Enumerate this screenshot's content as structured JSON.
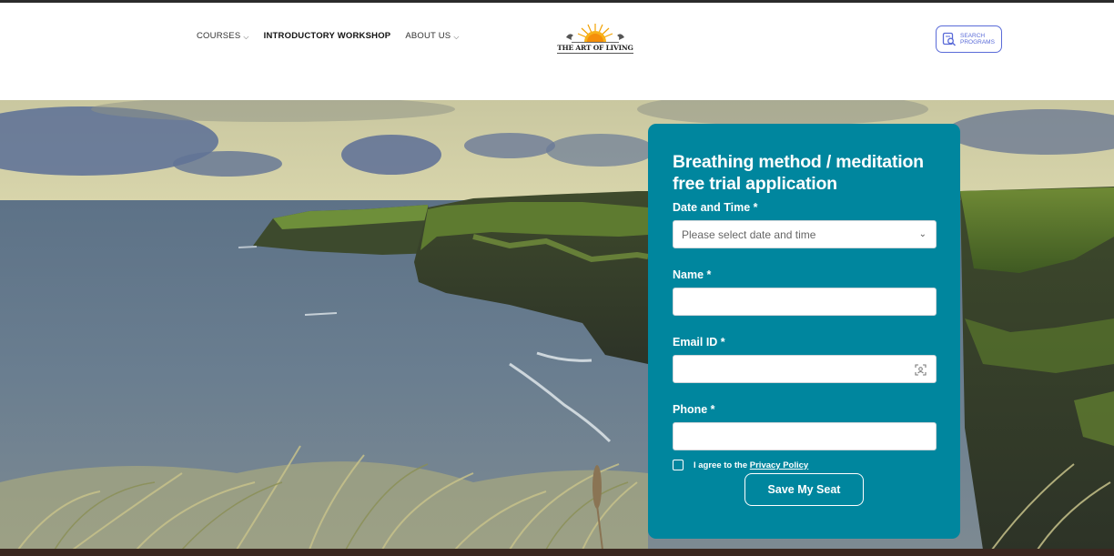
{
  "header": {
    "nav": [
      {
        "label": "COURSES",
        "has_dropdown": true
      },
      {
        "label": "INTRODUCTORY WORKSHOP",
        "has_dropdown": false
      },
      {
        "label": "ABOUT US",
        "has_dropdown": true
      }
    ],
    "logo": {
      "text": "THE ART OF LIVING",
      "icon": "rising-sun-logo"
    },
    "search": {
      "label": "SEARCH PROGRAMS",
      "icon": "search-icon",
      "accent": "#5a6bd8"
    }
  },
  "hero": {
    "image": "coastal-cliffs-photo"
  },
  "form": {
    "title": "Breathing method / meditation free trial application",
    "background": "#00869e",
    "fields": {
      "date": {
        "label": "Date and Time *",
        "placeholder": "Please select date and time"
      },
      "name": {
        "label": "Name *",
        "value": ""
      },
      "email": {
        "label": "Email ID *",
        "value": ""
      },
      "phone": {
        "label": "Phone *",
        "value": ""
      }
    },
    "agree_text": "I agree to the ",
    "agree_link": "Privacy Policy",
    "submit_label": "Save My Seat"
  }
}
